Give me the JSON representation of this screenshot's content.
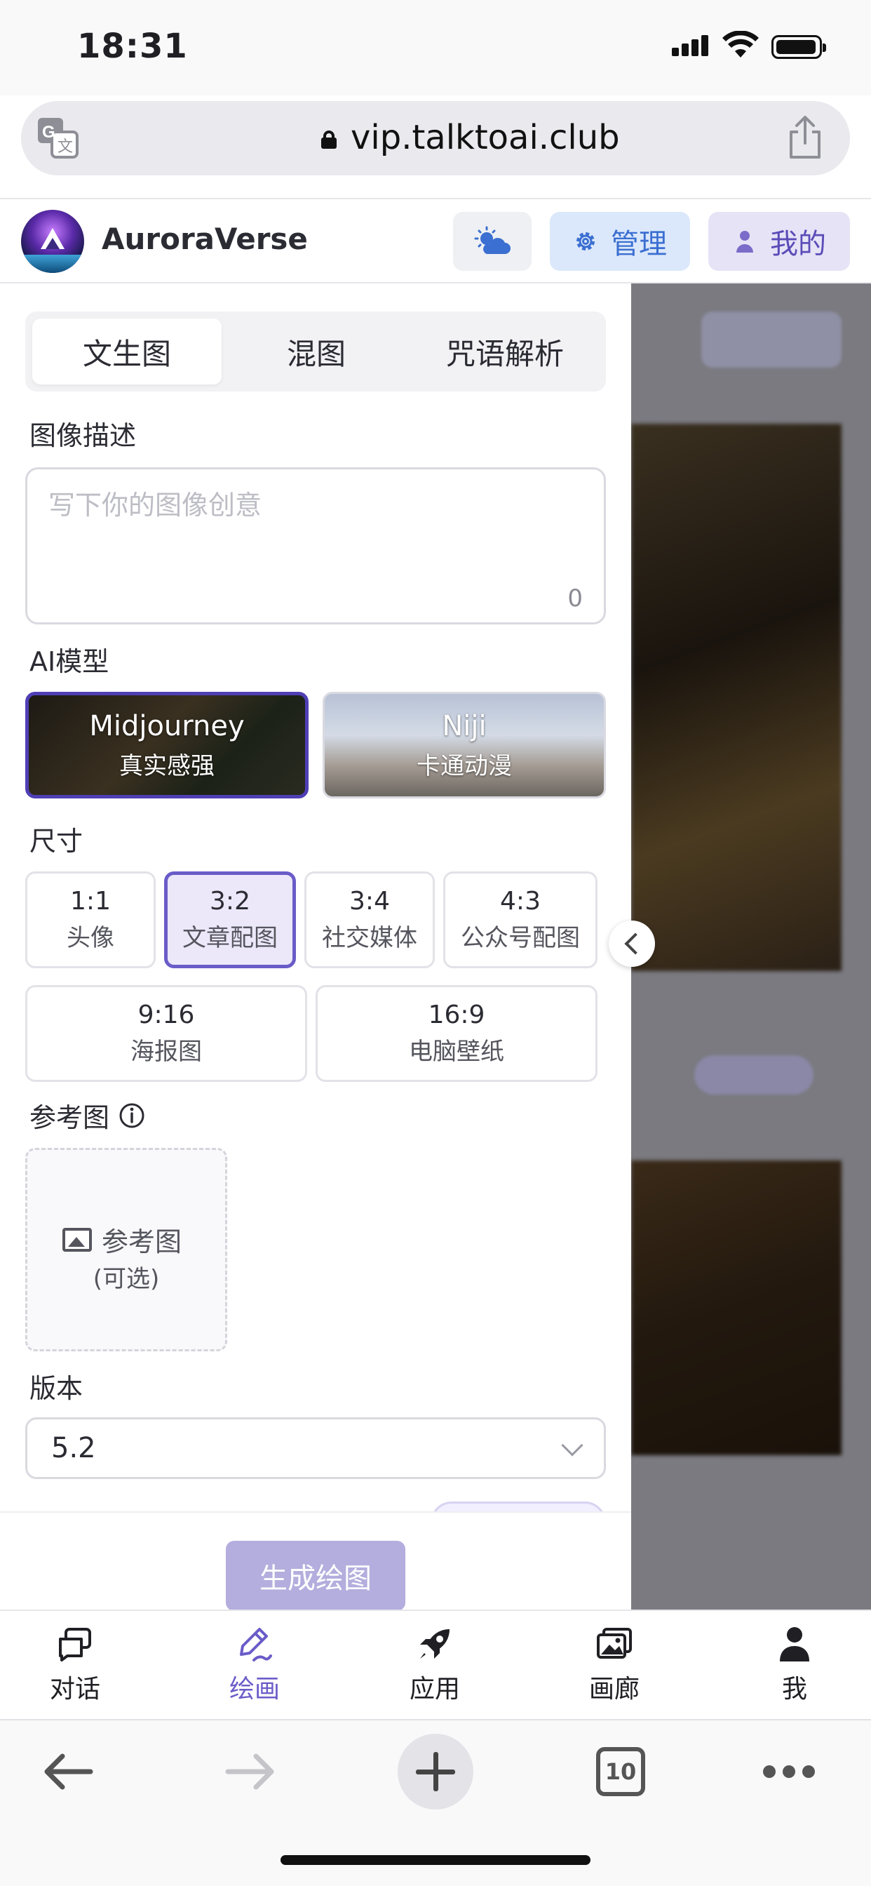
{
  "status_bar": {
    "time": "18:31"
  },
  "browser": {
    "url": "vip.talktoai.club",
    "tab_count": "10"
  },
  "header": {
    "brand": "AuroraVerse",
    "manage_label": "管理",
    "mine_label": "我的"
  },
  "panel": {
    "tabs": [
      {
        "label": "文生图",
        "active": true
      },
      {
        "label": "混图",
        "active": false
      },
      {
        "label": "咒语解析",
        "active": false
      }
    ],
    "description": {
      "label": "图像描述",
      "placeholder": "写下你的图像创意",
      "char_count": "0"
    },
    "model": {
      "label": "AI模型",
      "options": [
        {
          "name": "Midjourney",
          "subtitle": "真实感强",
          "selected": true
        },
        {
          "name": "Niji",
          "subtitle": "卡通动漫",
          "selected": false
        }
      ]
    },
    "size": {
      "label": "尺寸",
      "options": [
        {
          "ratio": "1:1",
          "name": "头像",
          "selected": false
        },
        {
          "ratio": "3:2",
          "name": "文章配图",
          "selected": true
        },
        {
          "ratio": "3:4",
          "name": "社交媒体",
          "selected": false
        },
        {
          "ratio": "4:3",
          "name": "公众号配图",
          "selected": false
        },
        {
          "ratio": "9:16",
          "name": "海报图",
          "selected": false
        },
        {
          "ratio": "16:9",
          "name": "电脑壁纸",
          "selected": false
        }
      ]
    },
    "reference": {
      "label": "参考图",
      "upload_label": "参考图",
      "upload_hint": "(可选)"
    },
    "version": {
      "label": "版本",
      "value": "5.2"
    },
    "generate_label": "生成绘图"
  },
  "bottom_nav": [
    {
      "label": "对话",
      "icon": "chat-icon",
      "active": false
    },
    {
      "label": "绘画",
      "icon": "paint-icon",
      "active": true
    },
    {
      "label": "应用",
      "icon": "rocket-icon",
      "active": false
    },
    {
      "label": "画廊",
      "icon": "gallery-icon",
      "active": false
    },
    {
      "label": "我",
      "icon": "person-icon",
      "active": false
    }
  ],
  "colors": {
    "accent": "#6a5cc8",
    "selected_bg": "#ece8fa",
    "generate_button": "#b3aedd",
    "manage_bg": "#dbe8fb",
    "mine_bg": "#e6e3f6"
  }
}
